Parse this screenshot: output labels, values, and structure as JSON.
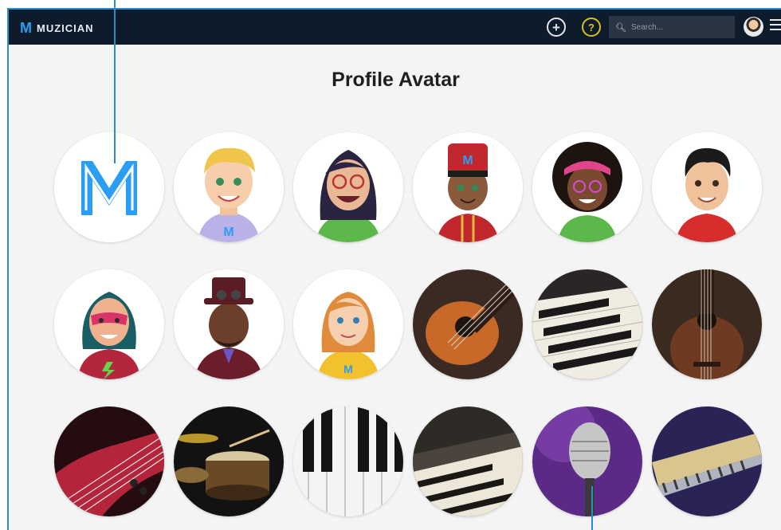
{
  "brand": {
    "mark": "M",
    "name": "MUZICIAN"
  },
  "header": {
    "add_icon": "plus-circle-icon",
    "help_icon": "question-circle-icon",
    "help_label": "?",
    "add_label": "+",
    "search_placeholder": "Search...",
    "search_icon": "search-icon",
    "menu_icon": "hamburger-menu-icon"
  },
  "page": {
    "title": "Profile Avatar"
  },
  "avatars": [
    {
      "name": "avatar-muzician-logo",
      "letter": "M"
    },
    {
      "name": "avatar-blond-boy"
    },
    {
      "name": "avatar-glasses-girl"
    },
    {
      "name": "avatar-drummer-boy",
      "letter": "M"
    },
    {
      "name": "avatar-afro-girl"
    },
    {
      "name": "avatar-dark-hair-boy"
    },
    {
      "name": "avatar-superhero-girl"
    },
    {
      "name": "avatar-steampunk-man"
    },
    {
      "name": "avatar-redhead-girl",
      "letter": "M"
    },
    {
      "name": "avatar-acoustic-guitar"
    },
    {
      "name": "avatar-piano-keys-angled"
    },
    {
      "name": "avatar-ukulele"
    },
    {
      "name": "avatar-bass-guitar"
    },
    {
      "name": "avatar-drum-kit"
    },
    {
      "name": "avatar-piano-keys"
    },
    {
      "name": "avatar-synthesizer"
    },
    {
      "name": "avatar-microphone"
    },
    {
      "name": "avatar-harmonica"
    }
  ],
  "colors": {
    "accent": "#2a9df4",
    "header_bg": "#0e1b2b",
    "callout": "#2a8fc9",
    "help": "#d8c21a"
  }
}
